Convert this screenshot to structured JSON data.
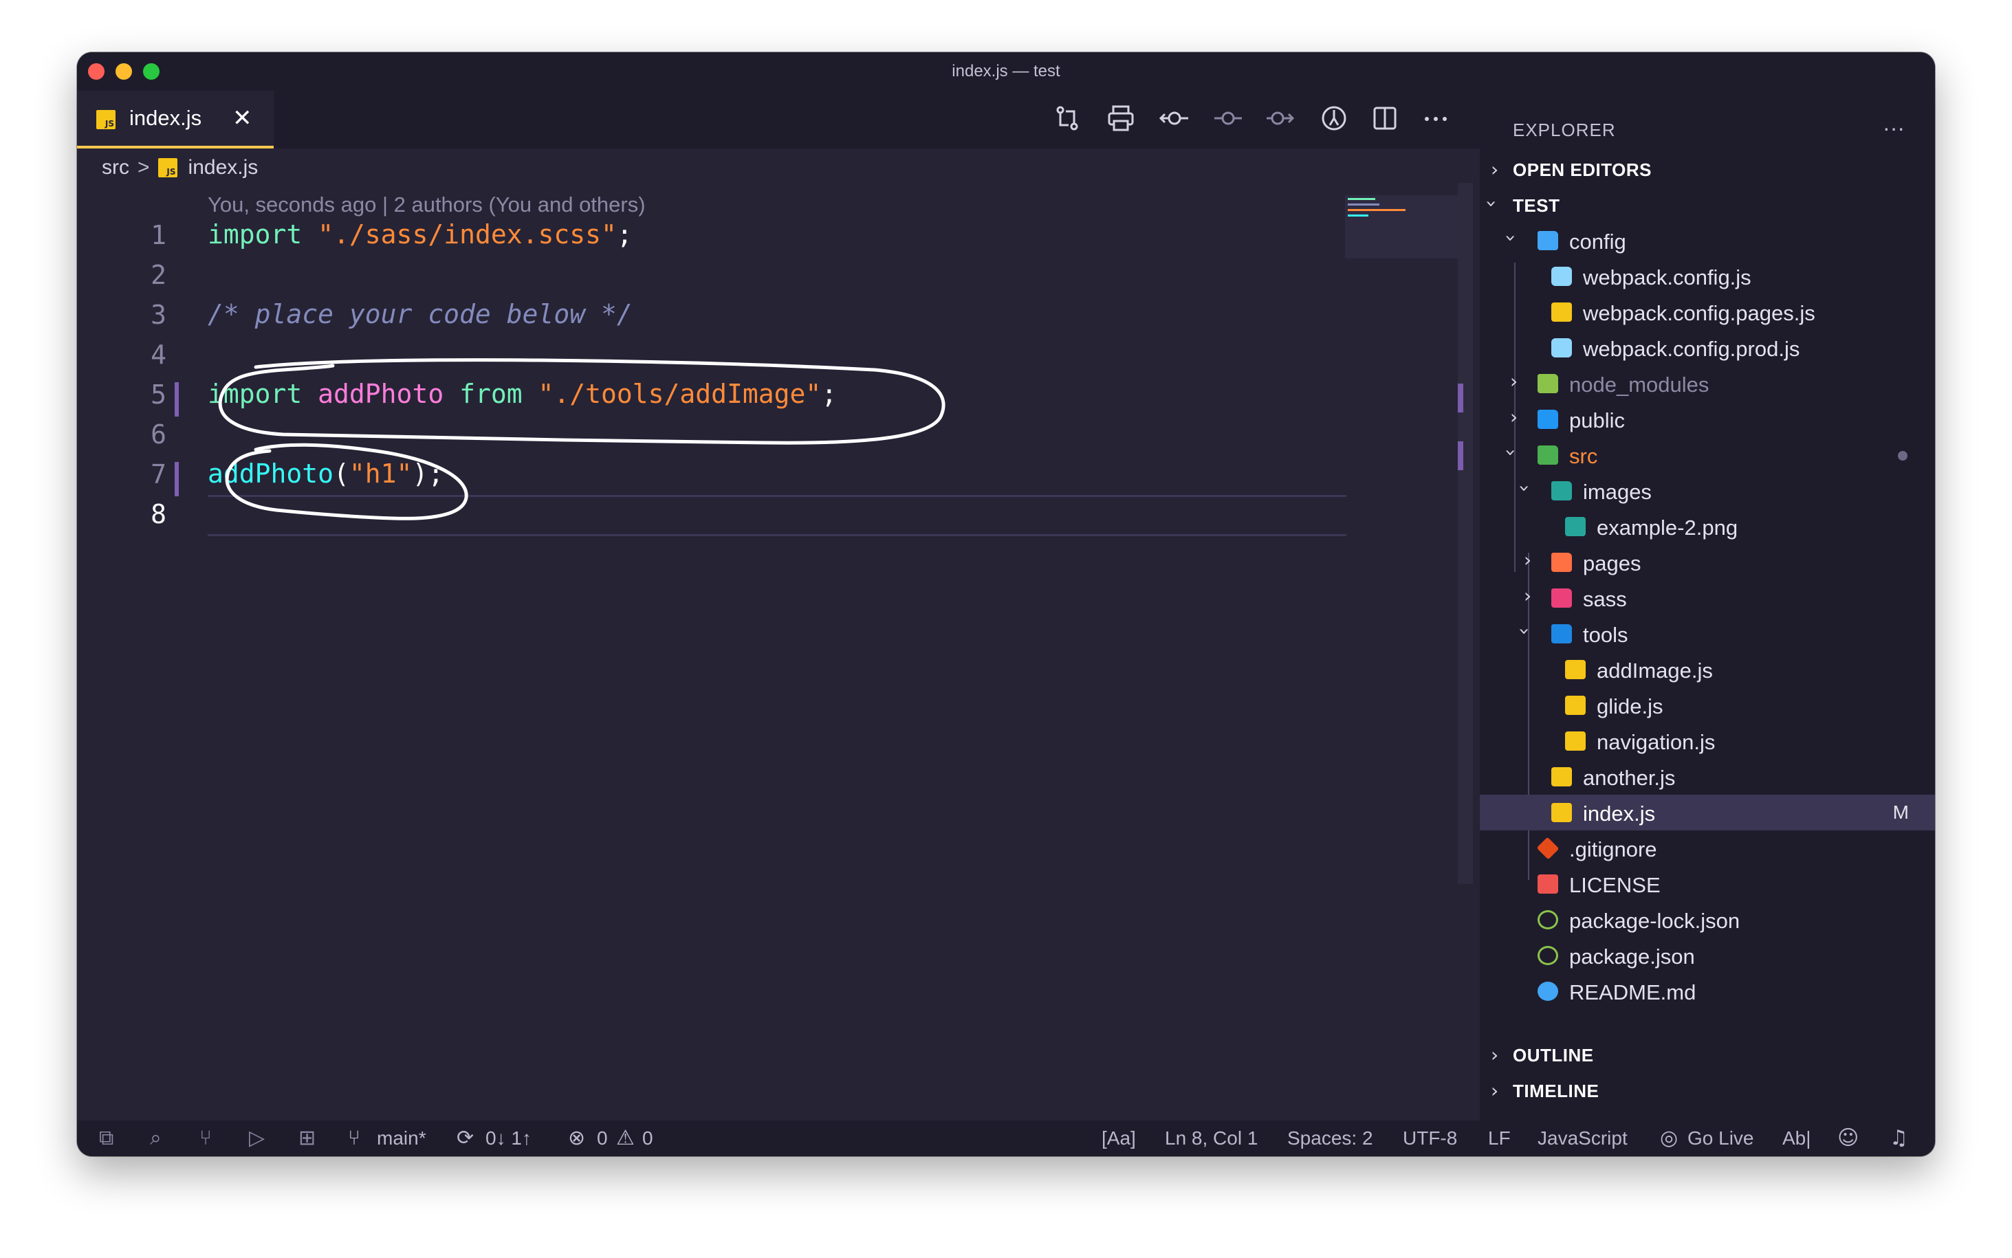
{
  "window": {
    "title": "index.js — test"
  },
  "tab": {
    "label": "index.js",
    "close": "✕",
    "icon_text": "JS",
    "icon": "js-file-icon"
  },
  "toolbar": {
    "icons": [
      "compare-changes-icon",
      "print-icon",
      "git-commit-icon",
      "git-commit-previous-icon",
      "git-commit-next-icon",
      "timeline-icon",
      "split-editor-icon",
      "more-actions-icon"
    ]
  },
  "breadcrumb": {
    "folder": "src",
    "separator": ">",
    "file": "index.js"
  },
  "editor": {
    "blame": "You, seconds ago | 2 authors (You and others)",
    "line_numbers": [
      "1",
      "2",
      "3",
      "4",
      "5",
      "6",
      "7",
      "8"
    ],
    "active_line": "8",
    "lines": {
      "l1": {
        "kw": "import",
        "space": " ",
        "str": "\"./sass/index.scss\"",
        "end": ";"
      },
      "l3": {
        "comment": "/* place your code below */"
      },
      "l5": {
        "kw1": "import",
        "s1": " ",
        "id": "addPhoto",
        "s2": " ",
        "kw2": "from",
        "s3": " ",
        "str": "\"./tools/addImage\"",
        "end": ";"
      },
      "l7": {
        "fn": "addPhoto",
        "open": "(",
        "str": "\"h1\"",
        "close": ")",
        "end": ";"
      }
    }
  },
  "sidebar": {
    "header": "EXPLORER",
    "more": "···",
    "sections": {
      "open_editors": "OPEN EDITORS",
      "test": "TEST",
      "outline": "OUTLINE",
      "timeline": "TIMELINE"
    },
    "tree": [
      {
        "label": "config",
        "type": "folder",
        "open": true
      },
      {
        "label": "webpack.config.js",
        "type": "webpack"
      },
      {
        "label": "webpack.config.pages.js",
        "type": "js"
      },
      {
        "label": "webpack.config.prod.js",
        "type": "webpack"
      },
      {
        "label": "node_modules",
        "type": "folder",
        "open": false
      },
      {
        "label": "public",
        "type": "folder",
        "open": false
      },
      {
        "label": "src",
        "type": "folder",
        "open": true
      },
      {
        "label": "images",
        "type": "folder",
        "open": true
      },
      {
        "label": "example-2.png",
        "type": "image"
      },
      {
        "label": "pages",
        "type": "folder",
        "open": false
      },
      {
        "label": "sass",
        "type": "folder",
        "open": false
      },
      {
        "label": "tools",
        "type": "folder",
        "open": true
      },
      {
        "label": "addImage.js",
        "type": "js"
      },
      {
        "label": "glide.js",
        "type": "js"
      },
      {
        "label": "navigation.js",
        "type": "js"
      },
      {
        "label": "another.js",
        "type": "js"
      },
      {
        "label": "index.js",
        "type": "js",
        "badge": "M",
        "selected": true
      },
      {
        "label": ".gitignore",
        "type": "git"
      },
      {
        "label": "LICENSE",
        "type": "license"
      },
      {
        "label": "package-lock.json",
        "type": "node"
      },
      {
        "label": "package.json",
        "type": "node"
      },
      {
        "label": "README.md",
        "type": "info"
      }
    ]
  },
  "statusbar": {
    "branch": "main*",
    "sync": "0↓ 1↑",
    "errors": "0",
    "warnings": "0",
    "case": "[Aa]",
    "position": "Ln 8, Col 1",
    "spaces": "Spaces: 2",
    "encoding": "UTF-8",
    "eol": "LF",
    "language": "JavaScript",
    "golive": "Go Live",
    "abl": "Ab|"
  },
  "colors": {
    "background": "#262335",
    "sidebar": "#1e1c2b",
    "keyword": "#72f1b8",
    "string": "#ff8b39",
    "function": "#36f9f6",
    "identifier": "#ff7edb",
    "comment": "#848bbd"
  }
}
